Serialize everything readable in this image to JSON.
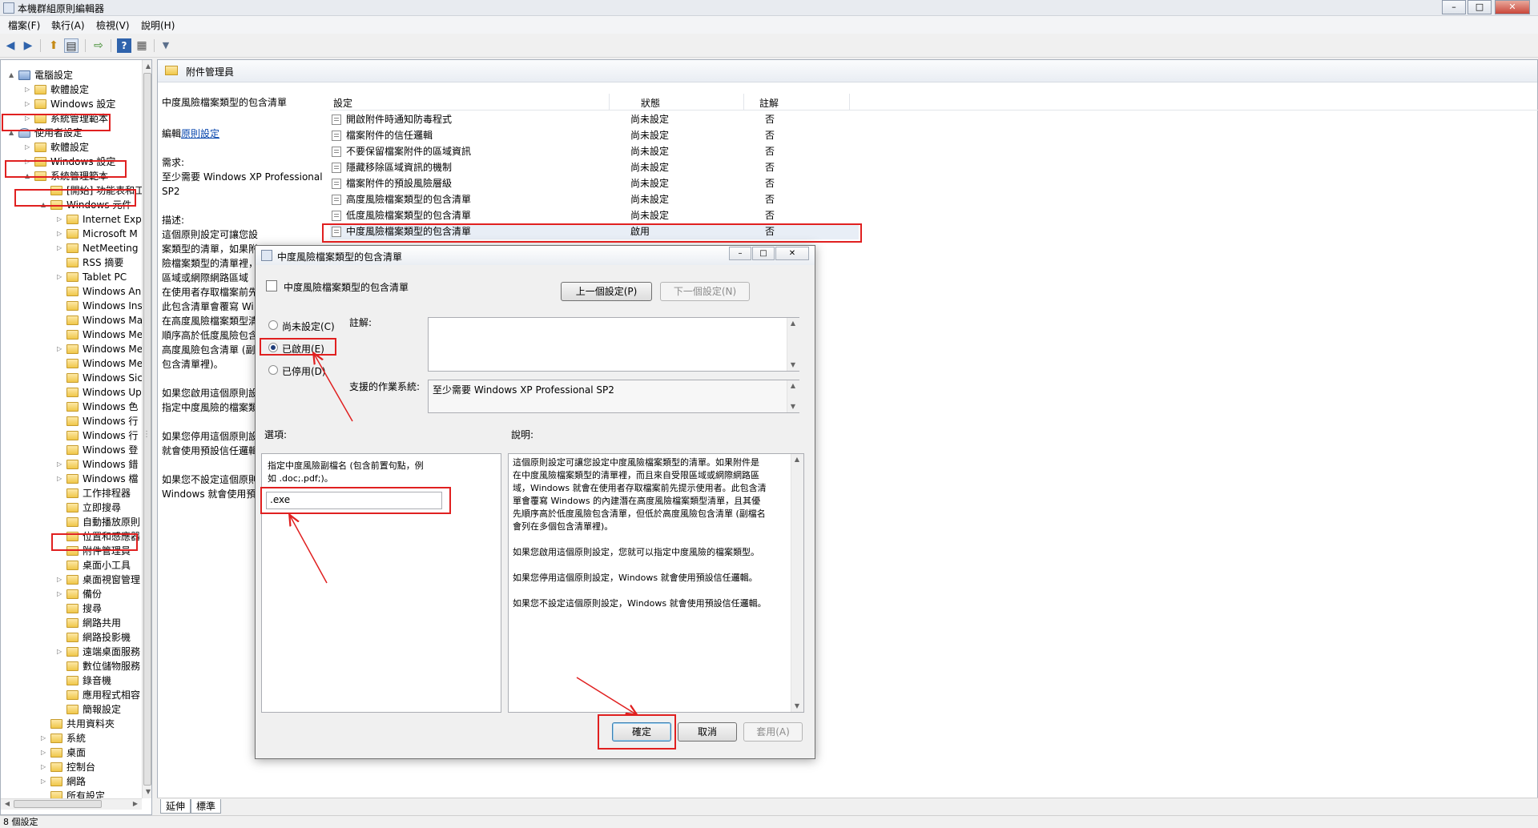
{
  "window": {
    "title": "本機群組原則編輯器",
    "buttons": {
      "minimize": "–",
      "maximize": "□",
      "close": "✕"
    }
  },
  "menu": [
    "檔案(F)",
    "執行(A)",
    "檢視(V)",
    "說明(H)"
  ],
  "toolbar": {
    "icons": [
      "back-arrow-icon",
      "forward-arrow-icon",
      "up-folder-icon",
      "show-hide-tree-icon",
      "export-list-icon",
      "help-icon",
      "properties-icon",
      "filter-icon"
    ],
    "glyphs": [
      "◀",
      "▶",
      "⬆",
      "▤",
      "⇨",
      "?",
      "▦",
      "▼"
    ]
  },
  "tree": {
    "nodes": [
      {
        "label": "電腦設定",
        "level": 0,
        "toggle": "▲",
        "icon": "computer"
      },
      {
        "label": "軟體設定",
        "level": 1,
        "toggle": "▷",
        "icon": "folder"
      },
      {
        "label": "Windows 設定",
        "level": 1,
        "toggle": "▷",
        "icon": "folder"
      },
      {
        "label": "系統管理範本",
        "level": 1,
        "toggle": "▷",
        "icon": "folder"
      },
      {
        "label": "使用者設定",
        "level": 0,
        "toggle": "▲",
        "icon": "user"
      },
      {
        "label": "軟體設定",
        "level": 1,
        "toggle": "▷",
        "icon": "folder"
      },
      {
        "label": "Windows 設定",
        "level": 1,
        "toggle": "▷",
        "icon": "folder"
      },
      {
        "label": "系統管理範本",
        "level": 1,
        "toggle": "▲",
        "icon": "folder"
      },
      {
        "label": "[開始] 功能表和工",
        "level": 2,
        "toggle": "",
        "icon": "folder"
      },
      {
        "label": "Windows 元件",
        "level": 2,
        "toggle": "▲",
        "icon": "folder"
      },
      {
        "label": "Internet Expl",
        "level": 3,
        "toggle": "▷",
        "icon": "folder"
      },
      {
        "label": "Microsoft M",
        "level": 3,
        "toggle": "▷",
        "icon": "folder"
      },
      {
        "label": "NetMeeting",
        "level": 3,
        "toggle": "▷",
        "icon": "folder"
      },
      {
        "label": "RSS 摘要",
        "level": 3,
        "toggle": "",
        "icon": "folder"
      },
      {
        "label": "Tablet PC",
        "level": 3,
        "toggle": "▷",
        "icon": "folder"
      },
      {
        "label": "Windows An",
        "level": 3,
        "toggle": "",
        "icon": "folder"
      },
      {
        "label": "Windows Ins",
        "level": 3,
        "toggle": "",
        "icon": "folder"
      },
      {
        "label": "Windows Ma",
        "level": 3,
        "toggle": "",
        "icon": "folder"
      },
      {
        "label": "Windows Me",
        "level": 3,
        "toggle": "",
        "icon": "folder"
      },
      {
        "label": "Windows Me",
        "level": 3,
        "toggle": "▷",
        "icon": "folder"
      },
      {
        "label": "Windows Me",
        "level": 3,
        "toggle": "",
        "icon": "folder"
      },
      {
        "label": "Windows Sic",
        "level": 3,
        "toggle": "",
        "icon": "folder"
      },
      {
        "label": "Windows Up",
        "level": 3,
        "toggle": "",
        "icon": "folder"
      },
      {
        "label": "Windows 色",
        "level": 3,
        "toggle": "",
        "icon": "folder"
      },
      {
        "label": "Windows 行",
        "level": 3,
        "toggle": "",
        "icon": "folder"
      },
      {
        "label": "Windows 行",
        "level": 3,
        "toggle": "",
        "icon": "folder"
      },
      {
        "label": "Windows 登",
        "level": 3,
        "toggle": "",
        "icon": "folder"
      },
      {
        "label": "Windows 錯",
        "level": 3,
        "toggle": "▷",
        "icon": "folder"
      },
      {
        "label": "Windows 檔",
        "level": 3,
        "toggle": "▷",
        "icon": "folder"
      },
      {
        "label": "工作排程器",
        "level": 3,
        "toggle": "",
        "icon": "folder"
      },
      {
        "label": "立即搜尋",
        "level": 3,
        "toggle": "",
        "icon": "folder"
      },
      {
        "label": "自動播放原則",
        "level": 3,
        "toggle": "",
        "icon": "folder"
      },
      {
        "label": "位置和感應器",
        "level": 3,
        "toggle": "",
        "icon": "folder"
      },
      {
        "label": "附件管理員",
        "level": 3,
        "toggle": "",
        "icon": "folder"
      },
      {
        "label": "桌面小工具",
        "level": 3,
        "toggle": "",
        "icon": "folder"
      },
      {
        "label": "桌面視窗管理",
        "level": 3,
        "toggle": "▷",
        "icon": "folder"
      },
      {
        "label": "備份",
        "level": 3,
        "toggle": "▷",
        "icon": "folder"
      },
      {
        "label": "搜尋",
        "level": 3,
        "toggle": "",
        "icon": "folder"
      },
      {
        "label": "網路共用",
        "level": 3,
        "toggle": "",
        "icon": "folder"
      },
      {
        "label": "網路投影機",
        "level": 3,
        "toggle": "",
        "icon": "folder"
      },
      {
        "label": "遠端桌面服務",
        "level": 3,
        "toggle": "▷",
        "icon": "folder"
      },
      {
        "label": "數位儲物服務",
        "level": 3,
        "toggle": "",
        "icon": "folder"
      },
      {
        "label": "錄音機",
        "level": 3,
        "toggle": "",
        "icon": "folder"
      },
      {
        "label": "應用程式相容",
        "level": 3,
        "toggle": "",
        "icon": "folder"
      },
      {
        "label": "簡報設定",
        "level": 3,
        "toggle": "",
        "icon": "folder"
      },
      {
        "label": "共用資料夾",
        "level": 2,
        "toggle": "",
        "icon": "folder"
      },
      {
        "label": "系統",
        "level": 2,
        "toggle": "▷",
        "icon": "folder"
      },
      {
        "label": "桌面",
        "level": 2,
        "toggle": "▷",
        "icon": "folder"
      },
      {
        "label": "控制台",
        "level": 2,
        "toggle": "▷",
        "icon": "folder"
      },
      {
        "label": "網路",
        "level": 2,
        "toggle": "▷",
        "icon": "folder"
      },
      {
        "label": "所有設定",
        "level": 2,
        "toggle": "",
        "icon": "folder"
      }
    ]
  },
  "folder_header": "附件管理員",
  "description": {
    "title": "中度風險檔案類型的包含清單",
    "edit_prefix": "編輯",
    "edit_link": "原則設定",
    "requirements_label": "需求:",
    "requirements_lines": [
      "至少需要 Windows XP Professional",
      "SP2"
    ],
    "description_label": "描述:",
    "lines": [
      "這個原則設定可讓您設定中度風險檔",
      "案類型的清單，如果附",
      "險檔案類型的清單裡，",
      "區域或網際網路區域",
      "在使用者存取檔案前先",
      "此包含清單會覆寫 Wi",
      "在高度風險檔案類型清",
      "順序高於低度風險包含",
      "高度風險包含清單 (副",
      "包含清單裡)。",
      "",
      "如果您啟用這個原則設",
      "指定中度風險的檔案類",
      "",
      "如果您停用這個原則設",
      "就會使用預設信任邏輯",
      "",
      "如果您不設定這個原則",
      "Windows 就會使用預"
    ]
  },
  "list": {
    "columns": [
      "設定",
      "狀態",
      "註解"
    ],
    "rows": [
      {
        "name": "開啟附件時通知防毒程式",
        "state": "尚未設定",
        "comment": "否"
      },
      {
        "name": "檔案附件的信任邏輯",
        "state": "尚未設定",
        "comment": "否"
      },
      {
        "name": "不要保留檔案附件的區域資訊",
        "state": "尚未設定",
        "comment": "否"
      },
      {
        "name": "隱藏移除區域資訊的機制",
        "state": "尚未設定",
        "comment": "否"
      },
      {
        "name": "檔案附件的預設風險層級",
        "state": "尚未設定",
        "comment": "否"
      },
      {
        "name": "高度風險檔案類型的包含清單",
        "state": "尚未設定",
        "comment": "否"
      },
      {
        "name": "低度風險檔案類型的包含清單",
        "state": "尚未設定",
        "comment": "否"
      },
      {
        "name": "中度風險檔案類型的包含清單",
        "state": "啟用",
        "comment": "否"
      }
    ]
  },
  "tabs": [
    "延伸",
    "標準"
  ],
  "status": "8 個設定",
  "dialog": {
    "title": "中度風險檔案類型的包含清單",
    "heading": "中度風險檔案類型的包含清單",
    "prev_button": "上一個設定(P)",
    "next_button": "下一個設定(N)",
    "radio_not_configured": "尚未設定(C)",
    "radio_enabled": "已啟用(E)",
    "radio_disabled": "已停用(D)",
    "selected_radio": "enabled",
    "comment_label": "註解:",
    "comment_value": "",
    "supported_label": "支援的作業系統:",
    "supported_value": "至少需要 Windows XP Professional SP2",
    "options_label": "選項:",
    "help_label": "說明:",
    "option_prompt_lines": [
      "指定中度風險副檔名 (包含前置句點，例",
      "如 .doc;.pdf;)。"
    ],
    "option_value": ".exe",
    "help_paragraphs": [
      [
        "這個原則設定可讓您設定中度風險檔案類型的清單。如果附件是",
        "在中度風險檔案類型的清單裡，而且來自受限區域或網際網路區",
        "域，Windows 就會在使用者存取檔案前先提示使用者。此包含清",
        "單會覆寫 Windows 的內建潛在高度風險檔案類型清單，且其優",
        "先順序高於低度風險包含清單，但低於高度風險包含清單 (副檔名",
        "會列在多個包含清單裡)。"
      ],
      [
        "如果您啟用這個原則設定，您就可以指定中度風險的檔案類型。"
      ],
      [
        "如果您停用這個原則設定，Windows 就會使用預設信任邏輯。"
      ],
      [
        "如果您不設定這個原則設定，Windows 就會使用預設信任邏輯。"
      ]
    ],
    "ok_button": "確定",
    "cancel_button": "取消",
    "apply_button": "套用(A)"
  },
  "annotation_color": "#e02020"
}
